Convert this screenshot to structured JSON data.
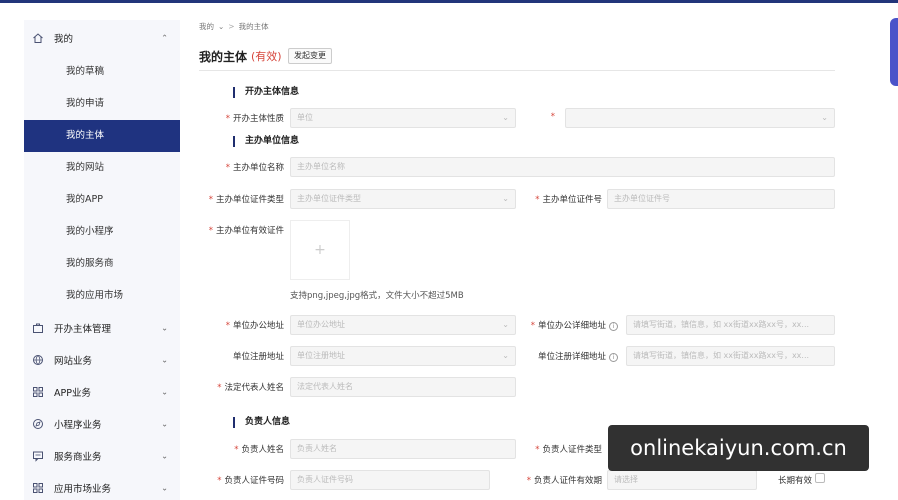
{
  "sidebar": {
    "my_group": {
      "label": "我的"
    },
    "my_items": [
      {
        "label": "我的草稿"
      },
      {
        "label": "我的申请"
      },
      {
        "label": "我的主体"
      },
      {
        "label": "我的网站"
      },
      {
        "label": "我的APP"
      },
      {
        "label": "我的小程序"
      },
      {
        "label": "我的服务商"
      },
      {
        "label": "我的应用市场"
      }
    ],
    "groups": [
      {
        "label": "开办主体管理",
        "icon": "briefcase-icon"
      },
      {
        "label": "网站业务",
        "icon": "globe-icon"
      },
      {
        "label": "APP业务",
        "icon": "app-grid-icon"
      },
      {
        "label": "小程序业务",
        "icon": "compass-icon"
      },
      {
        "label": "服务商业务",
        "icon": "message-icon"
      },
      {
        "label": "应用市场业务",
        "icon": "grid-icon"
      }
    ]
  },
  "breadcrumb": {
    "root": "我的",
    "separator": ">",
    "current": "我的主体"
  },
  "header": {
    "title": "我的主体",
    "status": "(有效)",
    "change_button": "发起变更"
  },
  "sections": {
    "organizer": "开办主体信息",
    "host_unit": "主办单位信息",
    "responsible": "负责人信息"
  },
  "fields": {
    "organizer_nature": {
      "label": "开办主体性质",
      "placeholder": "单位"
    },
    "unit_name": {
      "label": "主办单位名称",
      "placeholder": "主办单位名称"
    },
    "id_type": {
      "label": "主办单位证件类型",
      "placeholder": "主办单位证件类型"
    },
    "id_number": {
      "label": "主办单位证件号",
      "placeholder": "主办单位证件号"
    },
    "valid_cert": {
      "label": "主办单位有效证件",
      "hint": "支持png,jpeg,jpg格式，文件大小不超过5MB"
    },
    "office_address": {
      "label": "单位办公地址",
      "placeholder": "单位办公地址"
    },
    "office_detail": {
      "label": "单位办公详细地址",
      "placeholder": "请填写街道，镇信息，如 xx街道xx路xx号，xx..."
    },
    "reg_address": {
      "label": "单位注册地址",
      "placeholder": "单位注册地址"
    },
    "reg_detail": {
      "label": "单位注册详细地址",
      "placeholder": "请填写街道，镇信息，如 xx街道xx路xx号，xx..."
    },
    "legal_rep": {
      "label": "法定代表人姓名",
      "placeholder": "法定代表人姓名"
    },
    "person_name": {
      "label": "负责人姓名",
      "placeholder": "负责人姓名"
    },
    "person_id_type": {
      "label": "负责人证件类型"
    },
    "person_id_number": {
      "label": "负责人证件号码",
      "placeholder": "负责人证件号码"
    },
    "person_id_valid": {
      "label": "负责人证件有效期",
      "placeholder": "请选择"
    },
    "long_term": {
      "label": "长期有效"
    }
  },
  "watermark": "onlinekaiyun.com.cn",
  "colors": {
    "accent": "#1f3380",
    "required": "#d6453b",
    "status": "#d6453b"
  }
}
